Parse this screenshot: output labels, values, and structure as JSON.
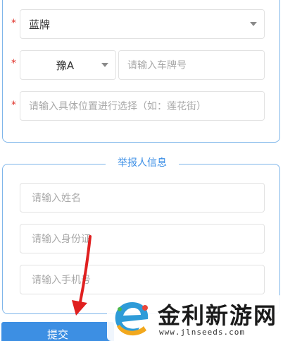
{
  "vehicle": {
    "required_mark": "*",
    "plate_color": {
      "value": "蓝牌"
    },
    "plate_prefix": {
      "value": "豫A"
    },
    "plate_number": {
      "placeholder": "请输入车牌号"
    },
    "location": {
      "placeholder": "请输入具体位置进行选择（如：莲花街）"
    }
  },
  "reporter": {
    "section_title": "举报人信息",
    "name": {
      "placeholder": "请输入姓名"
    },
    "id_card": {
      "placeholder": "请输入身份证"
    },
    "phone": {
      "placeholder": "请输入手机号"
    }
  },
  "actions": {
    "submit_label": "提交"
  },
  "watermark": {
    "title": "金利新游网",
    "url": "www.jlnseeds.com"
  },
  "icons": {
    "dropdown": "caret-down-icon",
    "annotation_arrow": "arrow-icon",
    "logo": "e-logo-icon"
  },
  "colors": {
    "accent": "#3a8ee6",
    "button": "#3d8fe3",
    "required": "#e0342c",
    "border": "#7fb6ea",
    "arrow": "#e02020"
  }
}
